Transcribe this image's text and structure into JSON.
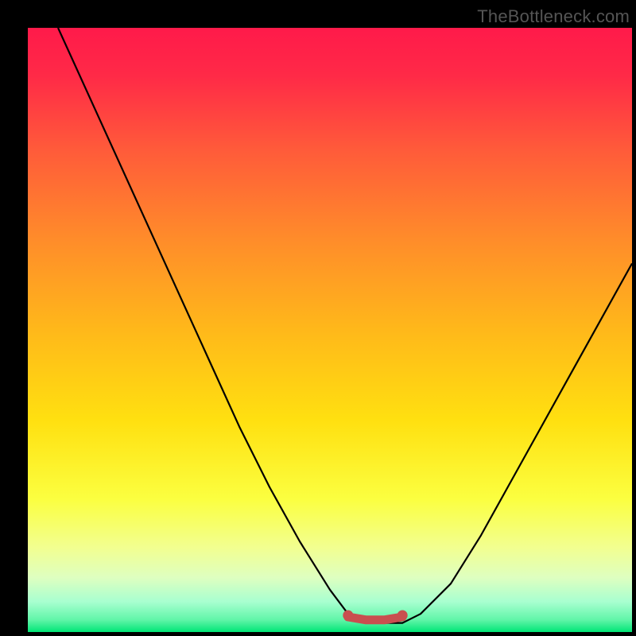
{
  "watermark": "TheBottleneck.com",
  "colors": {
    "bg_black": "#000000",
    "grad_top": "#ff1a4a",
    "grad_mid1": "#ff6a2a",
    "grad_mid2": "#ffd600",
    "grad_low1": "#f7ff5a",
    "grad_low2": "#d8ffb0",
    "grad_bottom": "#00e676",
    "curve_black": "#000000",
    "marker_red": "#c94f4f"
  },
  "chart_data": {
    "type": "line",
    "title": "",
    "xlabel": "",
    "ylabel": "",
    "xlim": [
      0,
      100
    ],
    "ylim": [
      0,
      100
    ],
    "series": [
      {
        "name": "bottleneck-curve",
        "x": [
          5,
          10,
          15,
          20,
          25,
          30,
          35,
          40,
          45,
          50,
          53,
          56,
          59,
          62,
          65,
          70,
          75,
          80,
          85,
          90,
          95,
          100
        ],
        "y": [
          100,
          89,
          78,
          67,
          56,
          45,
          34,
          24,
          15,
          7,
          3,
          1.5,
          1.5,
          1.5,
          3,
          8,
          16,
          25,
          34,
          43,
          52,
          61
        ]
      }
    ],
    "markers": {
      "name": "trough-segment",
      "x": [
        53,
        56,
        59,
        62
      ],
      "y": [
        2.5,
        2.0,
        2.0,
        2.5
      ],
      "color": "#c94f4f"
    }
  }
}
